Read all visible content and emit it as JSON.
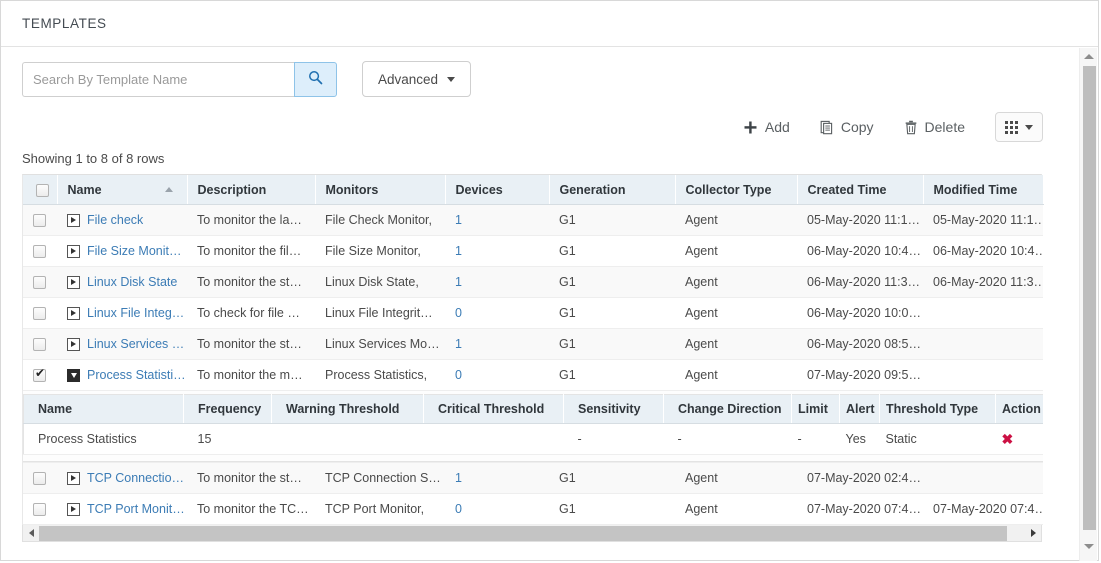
{
  "panel": {
    "title": "TEMPLATES"
  },
  "search": {
    "placeholder": "Search By Template Name",
    "value": "",
    "search_icon": "search-icon",
    "advanced_label": "Advanced"
  },
  "toolbar": {
    "add_label": "Add",
    "copy_label": "Copy",
    "delete_label": "Delete",
    "add_icon": "plus-icon",
    "copy_icon": "copy-icon",
    "delete_icon": "trash-icon",
    "grid_icon": "grid-view-icon"
  },
  "status": {
    "showing": "Showing 1 to 8 of 8 rows"
  },
  "table": {
    "columns": [
      "Name",
      "Description",
      "Monitors",
      "Devices",
      "Generation",
      "Collector Type",
      "Created Time",
      "Modified Time"
    ],
    "sort_column": "Name",
    "sort_direction": "asc",
    "rows": [
      {
        "selected": false,
        "expanded": false,
        "name": "File check",
        "description": "To monitor the la…",
        "monitors": "File Check Monitor,",
        "devices": "1",
        "generation": "G1",
        "collector_type": "Agent",
        "created_time": "05-May-2020 11:1…",
        "modified_time": "05-May-2020 11:1…"
      },
      {
        "selected": false,
        "expanded": false,
        "name": "File Size Monit…",
        "description": "To monitor the fil…",
        "monitors": "File Size Monitor,",
        "devices": "1",
        "generation": "G1",
        "collector_type": "Agent",
        "created_time": "06-May-2020 10:4…",
        "modified_time": "06-May-2020 10:4…"
      },
      {
        "selected": false,
        "expanded": false,
        "name": "Linux Disk State",
        "description": "To monitor the st…",
        "monitors": "Linux Disk State,",
        "devices": "1",
        "generation": "G1",
        "collector_type": "Agent",
        "created_time": "06-May-2020 11:3…",
        "modified_time": "06-May-2020 11:3…"
      },
      {
        "selected": false,
        "expanded": false,
        "name": "Linux File Integ…",
        "description": "To check for file …",
        "monitors": "Linux File Integrit…",
        "devices": "0",
        "generation": "G1",
        "collector_type": "Agent",
        "created_time": "06-May-2020 10:0…",
        "modified_time": ""
      },
      {
        "selected": false,
        "expanded": false,
        "name": "Linux Services …",
        "description": "To monitor the st…",
        "monitors": "Linux Services Mo…",
        "devices": "1",
        "generation": "G1",
        "collector_type": "Agent",
        "created_time": "06-May-2020 08:5…",
        "modified_time": ""
      },
      {
        "selected": true,
        "expanded": true,
        "name": "Process Statisti…",
        "description": "To monitor the m…",
        "monitors": "Process Statistics,",
        "devices": "0",
        "generation": "G1",
        "collector_type": "Agent",
        "created_time": "07-May-2020 09:5…",
        "modified_time": ""
      },
      {
        "selected": false,
        "expanded": false,
        "name": "TCP Connectio…",
        "description": "To monitor the st…",
        "monitors": "TCP Connection S…",
        "devices": "1",
        "generation": "G1",
        "collector_type": "Agent",
        "created_time": "07-May-2020 02:4…",
        "modified_time": ""
      },
      {
        "selected": false,
        "expanded": false,
        "name": "TCP Port Monit…",
        "description": "To monitor the TC…",
        "monitors": "TCP Port Monitor,",
        "devices": "0",
        "generation": "G1",
        "collector_type": "Agent",
        "created_time": "07-May-2020 07:4…",
        "modified_time": "07-May-2020 07:4…"
      }
    ]
  },
  "subtable": {
    "columns": [
      "Name",
      "Frequency",
      "Warning Threshold",
      "Critical Threshold",
      "Sensitivity",
      "Change Direction",
      "Limit",
      "Alert",
      "Threshold Type",
      "Action"
    ],
    "rows": [
      {
        "name": "Process Statistics",
        "frequency": "15",
        "warning_threshold": "",
        "critical_threshold": "",
        "sensitivity": "-",
        "change_direction": "-",
        "limit": "-",
        "alert": "Yes",
        "threshold_type": "Static",
        "action_icon": "delete-x-icon"
      }
    ]
  },
  "colors": {
    "link": "#3c7cb5",
    "header_bg": "#e9f0f5",
    "search_btn_bg": "#ddeefb",
    "delete_x": "#cc1144"
  }
}
